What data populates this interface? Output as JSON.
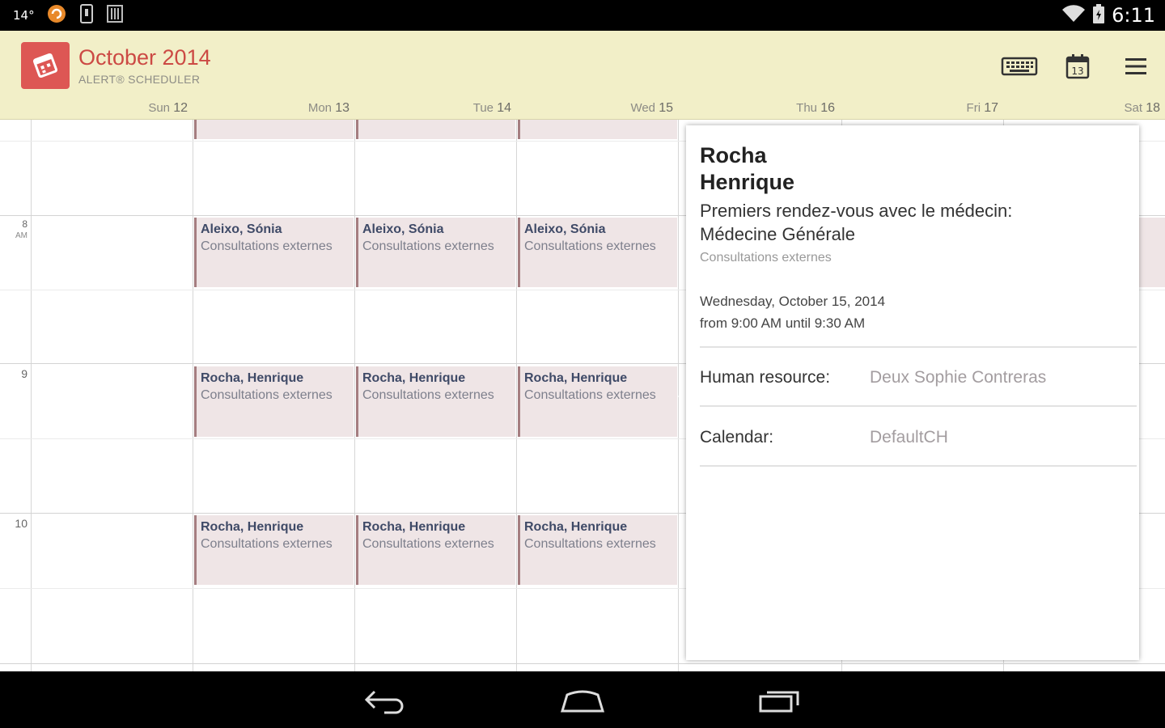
{
  "status_bar": {
    "temperature": "14°",
    "time": "6:11"
  },
  "header": {
    "title": "October 2014",
    "subtitle": "ALERT® SCHEDULER",
    "calendar_icon_day": "13"
  },
  "days": [
    {
      "name": "Sun",
      "num": "12"
    },
    {
      "name": "Mon",
      "num": "13"
    },
    {
      "name": "Tue",
      "num": "14"
    },
    {
      "name": "Wed",
      "num": "15"
    },
    {
      "name": "Thu",
      "num": "16"
    },
    {
      "name": "Fri",
      "num": "17"
    },
    {
      "name": "Sat",
      "num": "18"
    }
  ],
  "hours": [
    {
      "label": "8",
      "suffix": "AM"
    },
    {
      "label": "9",
      "suffix": ""
    },
    {
      "label": "10",
      "suffix": ""
    }
  ],
  "events": {
    "row8": {
      "name": "Aleixo, Sónia",
      "desc": "Consultations externes"
    },
    "row9": {
      "name": "Rocha, Henrique",
      "desc": "Consultations externes"
    },
    "row10": {
      "name": "Rocha, Henrique",
      "desc": "Consultations externes"
    }
  },
  "popup": {
    "name_line1": "Rocha",
    "name_line2": "Henrique",
    "type_line1": "Premiers rendez-vous avec le médecin:",
    "type_line2": "Médecine Générale",
    "category": "Consultations externes",
    "date": "Wednesday, October 15, 2014",
    "time_range": "from 9:00 AM until 9:30 AM",
    "resource_label": "Human resource:",
    "resource_value": "Deux Sophie Contreras",
    "calendar_label": "Calendar:",
    "calendar_value": "DefaultCH"
  }
}
